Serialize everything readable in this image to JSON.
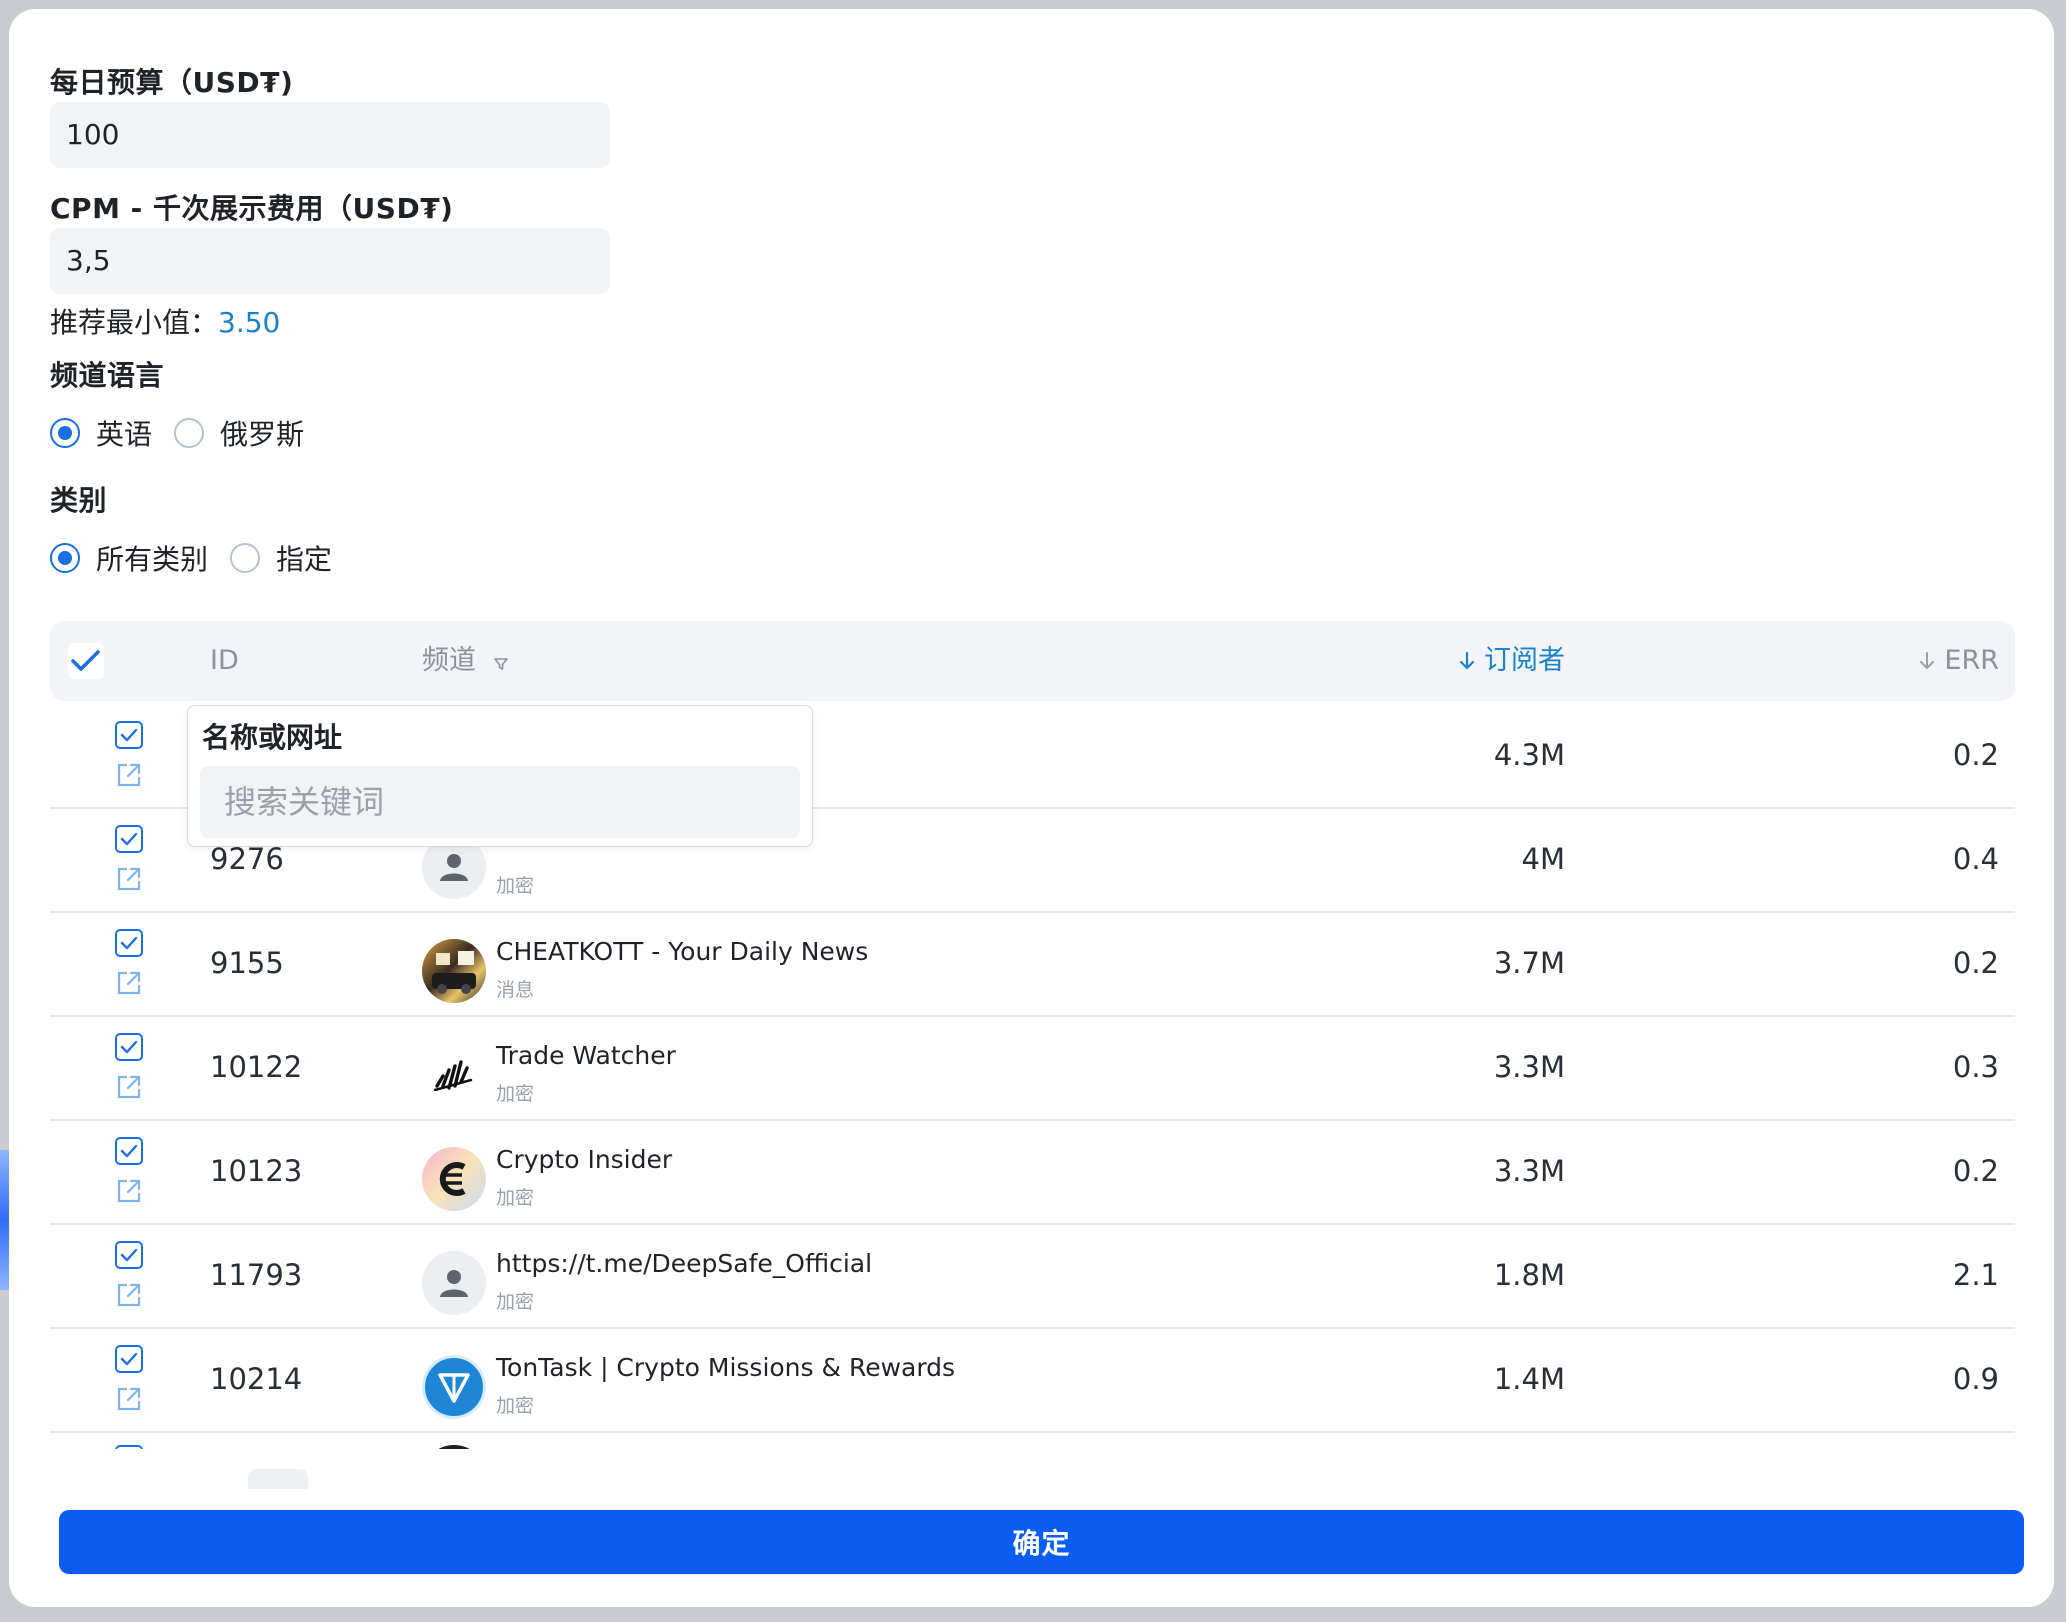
{
  "form": {
    "daily_budget_label": "每日预算（USD₮)",
    "daily_budget_value": "100",
    "cpm_label": "CPM - 千次展示费用（USD₮)",
    "cpm_value": "3,5",
    "recommend_label": "推荐最小值：",
    "recommend_value": "3.50",
    "language_label": "频道语言",
    "language_options": [
      "英语",
      "俄罗斯"
    ],
    "language_selected": "英语",
    "category_label": "类别",
    "category_options": [
      "所有类别",
      "指定"
    ],
    "category_selected": "所有类别"
  },
  "table": {
    "headers": {
      "id": "ID",
      "channel": "频道",
      "subscribers": "订阅者",
      "err": "ERR"
    },
    "sort_active": "subscribers",
    "rows": [
      {
        "id": "",
        "name": "",
        "category": "",
        "subscribers": "4.3M",
        "err": "0.2",
        "avatar": "hidden",
        "checked": true
      },
      {
        "id": "9276",
        "name": "",
        "category": "加密",
        "subscribers": "4M",
        "err": "0.4",
        "avatar": "person-icon",
        "checked": true
      },
      {
        "id": "9155",
        "name": "CHEATKOTT - Your Daily News",
        "category": "消息",
        "subscribers": "3.7M",
        "err": "0.2",
        "avatar": "photo-avatar",
        "checked": true
      },
      {
        "id": "10122",
        "name": "Trade Watcher",
        "category": "加密",
        "subscribers": "3.3M",
        "err": "0.3",
        "avatar": "trade-logo-icon",
        "checked": true
      },
      {
        "id": "10123",
        "name": "Crypto Insider",
        "category": "加密",
        "subscribers": "3.3M",
        "err": "0.2",
        "avatar": "crypto-insider-logo-icon",
        "checked": true
      },
      {
        "id": "11793",
        "name": "https://t.me/DeepSafe_Official",
        "category": "加密",
        "subscribers": "1.8M",
        "err": "2.1",
        "avatar": "person-icon",
        "checked": true
      },
      {
        "id": "10214",
        "name": "TonTask | Crypto Missions & Rewards",
        "category": "加密",
        "subscribers": "1.4M",
        "err": "0.9",
        "avatar": "ton-logo-icon",
        "checked": true
      }
    ]
  },
  "filter_popover": {
    "title": "名称或网址",
    "placeholder": "搜索关键词"
  },
  "confirm_label": "确定",
  "colors": {
    "accent": "#1b6fe0",
    "primary_button": "#0b5cf2",
    "link_value": "#1b82c7"
  }
}
